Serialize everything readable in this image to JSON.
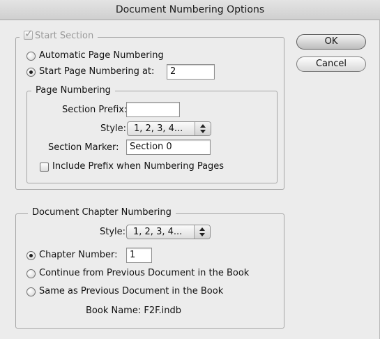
{
  "window": {
    "title": "Document Numbering Options"
  },
  "buttons": {
    "ok": "OK",
    "cancel": "Cancel"
  },
  "start_section": {
    "label": "Start Section",
    "checked": true,
    "enabled": false,
    "automatic_label": "Automatic Page Numbering",
    "start_at_label": "Start Page Numbering at:",
    "start_at_value": "2",
    "selected_option": "start_at"
  },
  "page_numbering": {
    "legend": "Page Numbering",
    "section_prefix_label": "Section Prefix:",
    "section_prefix_value": "",
    "style_label": "Style:",
    "style_value": "1, 2, 3, 4...",
    "section_marker_label": "Section Marker:",
    "section_marker_value": "Section 0",
    "include_prefix_label": "Include Prefix when Numbering Pages",
    "include_prefix_checked": false
  },
  "chapter_numbering": {
    "legend": "Document Chapter Numbering",
    "style_label": "Style:",
    "style_value": "1, 2, 3, 4...",
    "chapter_number_label": "Chapter Number:",
    "chapter_number_value": "1",
    "continue_label": "Continue from Previous Document in the Book",
    "same_label": "Same as Previous Document in the Book",
    "selected_option": "chapter_number",
    "book_name_label": "Book Name: F2F.indb"
  },
  "icons": {
    "check": "checkmark-icon",
    "select_arrows": "up-down-arrows-icon"
  }
}
